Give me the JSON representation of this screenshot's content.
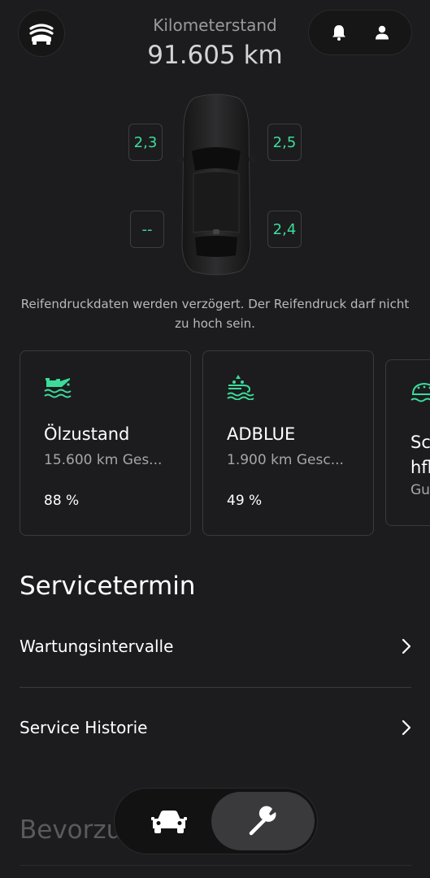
{
  "header": {
    "menu_icon": "car-stack-icon",
    "odometer_label": "Kilometerstand",
    "odometer_value": "91.605 km",
    "bell_icon": "bell-icon",
    "profile_icon": "person-icon"
  },
  "tires": {
    "front_left": "2,3",
    "front_right": "2,5",
    "rear_left": "--",
    "rear_right": "2,4"
  },
  "tire_note": "Reifendruckdaten werden verzögert. Der Reifendruck darf nicht zu hoch sein.",
  "cards": [
    {
      "icon": "oil-can-icon",
      "title": "Ölzustand",
      "subtitle": "15.600 km Ges...",
      "percent": "88 %"
    },
    {
      "icon": "adblue-icon",
      "title": "ADBLUE",
      "subtitle": "1.900 km Gesc...",
      "percent": "49 %"
    },
    {
      "icon": "washer-fluid-icon",
      "title": "Sc hfl",
      "subtitle": "Gu"
    }
  ],
  "service": {
    "title": "Servicetermin",
    "rows": [
      {
        "label": "Wartungsintervalle"
      },
      {
        "label": "Service Historie"
      }
    ]
  },
  "next_section_title": "Bevorzu",
  "tabbar": {
    "tabs": [
      {
        "icon": "car-icon",
        "active": false
      },
      {
        "icon": "wrench-icon",
        "active": true
      }
    ]
  },
  "colors": {
    "background": "#1c1c1e",
    "accent": "#3ddc9b"
  }
}
